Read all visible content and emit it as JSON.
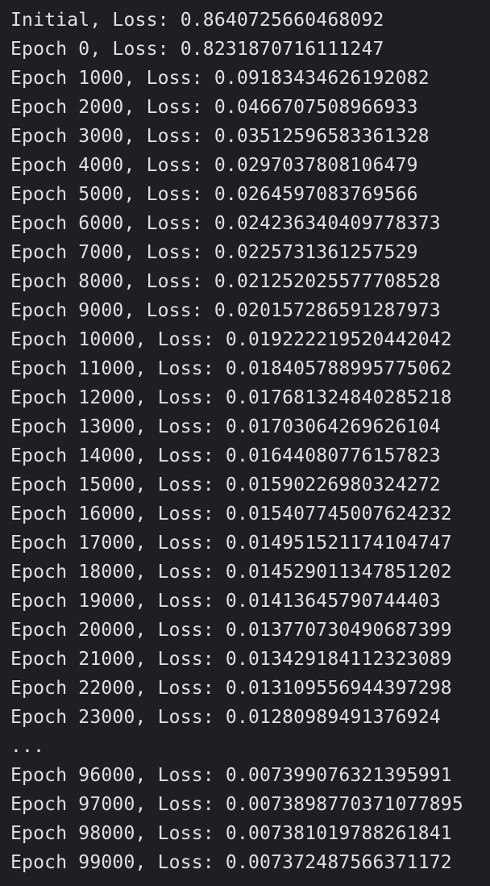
{
  "console": {
    "lines": [
      "Initial, Loss: 0.8640725660468092",
      "Epoch 0, Loss: 0.8231870716111247",
      "Epoch 1000, Loss: 0.09183434626192082",
      "Epoch 2000, Loss: 0.0466707508966933",
      "Epoch 3000, Loss: 0.03512596583361328",
      "Epoch 4000, Loss: 0.0297037808106479",
      "Epoch 5000, Loss: 0.0264597083769566",
      "Epoch 6000, Loss: 0.024236340409778373",
      "Epoch 7000, Loss: 0.0225731361257529",
      "Epoch 8000, Loss: 0.021252025577708528",
      "Epoch 9000, Loss: 0.020157286591287973",
      "Epoch 10000, Loss: 0.019222219520442042",
      "Epoch 11000, Loss: 0.018405788995775062",
      "Epoch 12000, Loss: 0.017681324840285218",
      "Epoch 13000, Loss: 0.0170306426962 6104",
      "Epoch 14000, Loss: 0.016440807761578 23",
      "Epoch 15000, Loss: 0.0159022698032 4272",
      "Epoch 16000, Loss: 0.015407745007624232",
      "Epoch 17000, Loss: 0.014951521174104747",
      "Epoch 18000, Loss: 0.014529011347851202",
      "Epoch 19000, Loss: 0.0141364579074 4403",
      "Epoch 20000, Loss: 0.013770730490687399",
      "Epoch 21000, Loss: 0.013429184112323089",
      "Epoch 22000, Loss: 0.013109556944397298",
      "Epoch 23000, Loss: 0.01280989491376924",
      "...",
      "Epoch 96000, Loss: 0.007399076321395991",
      "Epoch 97000, Loss: 0.0073898770371077895",
      "Epoch 98000, Loss: 0.007381019788261841",
      "Epoch 99000, Loss: 0.007372487566371172"
    ]
  },
  "colors": {
    "background": "#1e1f22",
    "text": "#dfe1e5"
  }
}
